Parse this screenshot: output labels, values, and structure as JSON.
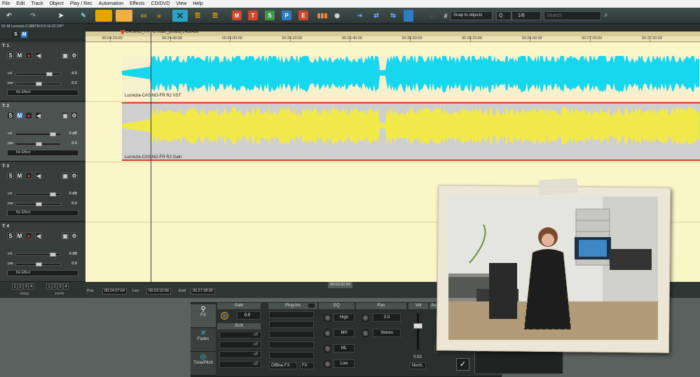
{
  "menu": [
    "File",
    "Edit",
    "Track",
    "Object",
    "Play / Rec",
    "Automation",
    "Effects",
    "CD/DVD",
    "View",
    "Help"
  ],
  "project": {
    "filename": "03 48 Lucrezia C MMTM 8 9-16-22.VIP*",
    "object_name": "CASINO_FR R2 main_[mstrd] 24bit48k"
  },
  "toolbar": {
    "snap_label": "Snap to objects",
    "quantize_label": "Q",
    "quantize_value": "1/8",
    "search_placeholder": "Search",
    "fx_buttons": [
      "M",
      "T",
      "S",
      "P",
      "E"
    ]
  },
  "ruler": {
    "ticks": [
      "00:24:20:00",
      "00:24:40:00",
      "00:25:00:00",
      "00:25:20:00",
      "00:25:40:00",
      "00:26:00:00",
      "00:26:20:00",
      "00:26:40:00",
      "00:27:00:00",
      "00:27:20:00"
    ]
  },
  "tracks": [
    {
      "name": "T: 1",
      "vol_label": "vol",
      "vol": "-4.5",
      "pan_label": "pan",
      "pan": "0.0",
      "fx_label": "FX",
      "fx": "No Effect",
      "clip": "Lucrezia-CASINO-FR R2  VST"
    },
    {
      "name": "T: 2",
      "vol_label": "vol",
      "vol": "0 dB",
      "pan_label": "pan",
      "pan": "0.0",
      "fx_label": "FX",
      "fx": "No Effect",
      "clip": "Lucrezia-CASINO-FR R2  Gain"
    },
    {
      "name": "T: 3",
      "vol_label": "vol",
      "vol": "0 dB",
      "pan_label": "pan",
      "pan": "0.0",
      "fx_label": "FX",
      "fx": "No Effect"
    },
    {
      "name": "T: 4",
      "vol_label": "vol",
      "vol": "0 dB",
      "pan_label": "pan",
      "pan": "0.0",
      "fx_label": "FX",
      "fx": "No Effect"
    }
  ],
  "track_buttons": {
    "solo": "S",
    "mute": "M"
  },
  "footer": {
    "pages": [
      "1",
      "2",
      "3",
      "4"
    ],
    "setup_label": "setup",
    "zoom_label": "zoom"
  },
  "status": {
    "pos_label": "Pos",
    "pos": "00:24:37:04",
    "len_label": "Len",
    "len": "00:03:10:06",
    "end_label": "End",
    "end": "00:27:38:05",
    "center": "00:03:32:09"
  },
  "mixer": {
    "tabs": [
      "FX",
      "Fades",
      "Time/Pitch"
    ],
    "gain_label": "Gain",
    "gain_value": "0.0",
    "aux_label": "AUX",
    "aux_slots": [
      "off",
      "off",
      "off",
      "off"
    ],
    "plugins_label": "Plug-ins",
    "offline_fx": "Offline FX",
    "fx_label": "FX",
    "eq_label": "EQ",
    "eq_bands": [
      "High",
      "MH",
      "ML",
      "Low"
    ],
    "pan_label": "Pan",
    "pan_value": "0.0",
    "pan_mode": "Stereo",
    "vol_label": "Vol",
    "vol_value": "0.00",
    "norm_label": "Norm.",
    "au_label": "Au",
    "comments_label": "Comments:"
  },
  "colors": {
    "wave1": "#17d7ee",
    "wave2": "#f1e84a",
    "accent": "#2fa3c7"
  }
}
